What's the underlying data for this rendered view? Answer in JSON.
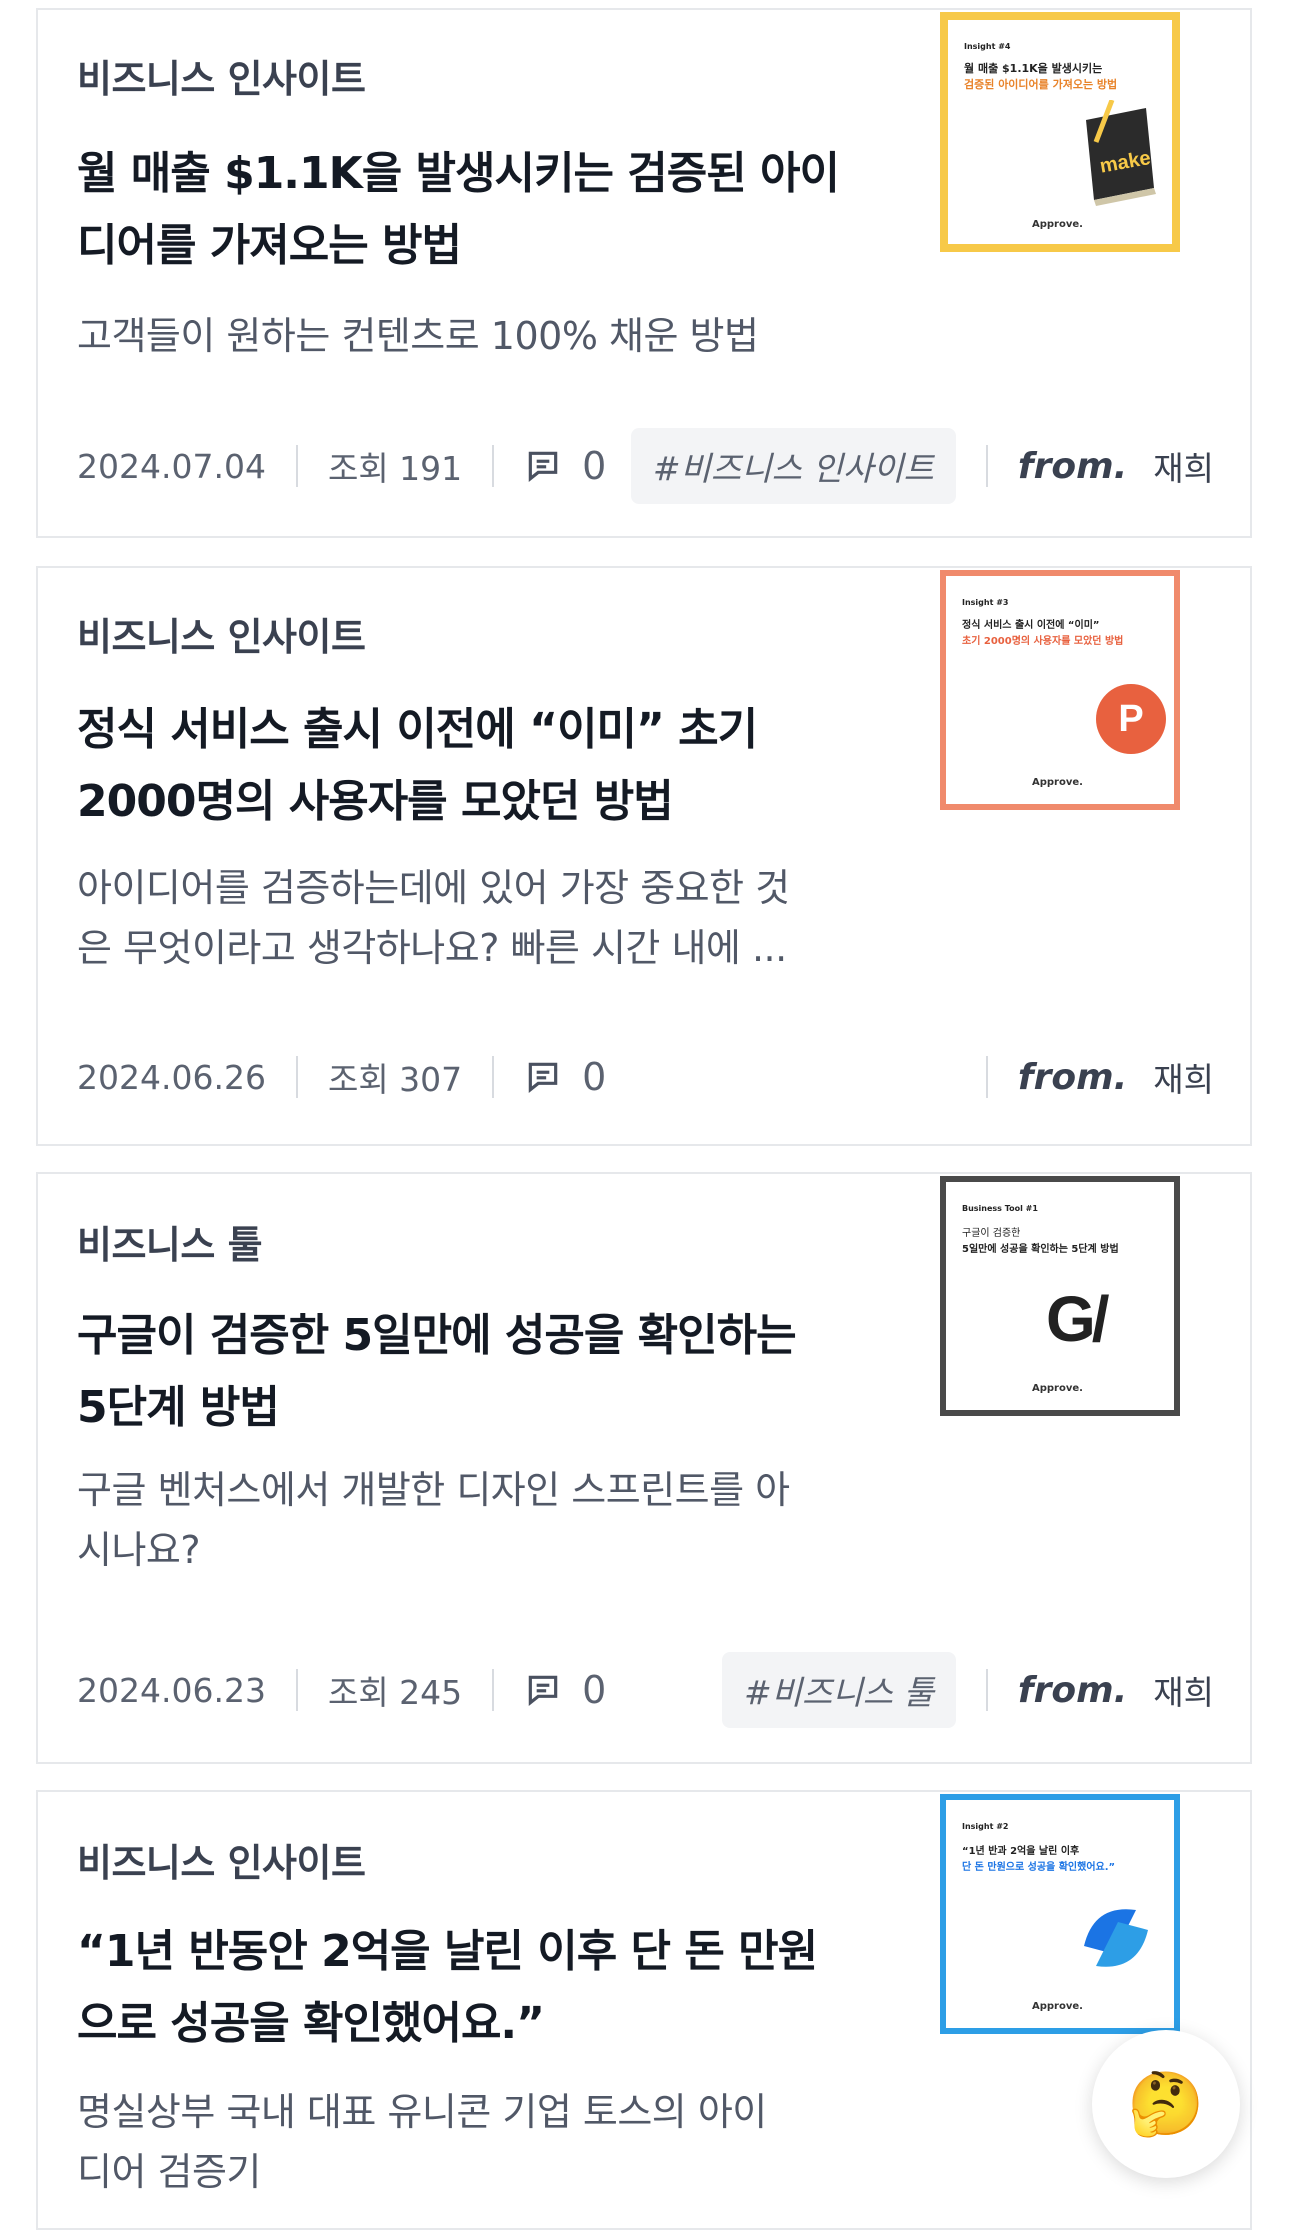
{
  "posts": [
    {
      "category": "비즈니스 인사이트",
      "title_line1": "월 매출 $1.1K을 발생시키는 검증된 아이",
      "title_line2": "디어를 가져오는 방법",
      "desc_line1": "고객들이 원하는 컨텐츠로 100% 채운 방법",
      "desc_line2": "",
      "date": "2024.07.04",
      "views": "조회 191",
      "comments": "0",
      "tag": "#비즈니스 인사이트",
      "from": "from.",
      "author": "재희",
      "thumb": {
        "small": "Insight #4",
        "line1": "월 매출 $1.1K을 발생시키는",
        "line2": "검증된 아이디어를 가져오는 방법",
        "brand": "Approve.",
        "book_text": "make",
        "frame_color": "#f7c948",
        "accent_color": "#e8832a"
      }
    },
    {
      "category": "비즈니스 인사이트",
      "title_line1": "정식 서비스 출시 이전에 “이미” 초기",
      "title_line2": "2000명의 사용자를 모았던 방법",
      "desc_line1": "아이디어를 검증하는데에 있어 가장 중요한 것",
      "desc_line2": "은 무엇이라고 생각하나요? 빠른 시간 내에 ...",
      "date": "2024.06.26",
      "views": "조회 307",
      "comments": "0",
      "tag": "",
      "from": "from.",
      "author": "재희",
      "thumb": {
        "small": "Insight #3",
        "line1": "정식 서비스 출시 이전에 “이미”",
        "line2": "초기 2000명의 사용자를 모았던 방법",
        "brand": "Approve.",
        "logo_letter": "P",
        "frame_color": "#f08a6c",
        "accent_color": "#e8613f"
      }
    },
    {
      "category": "비즈니스 툴",
      "title_line1": "구글이 검증한 5일만에 성공을 확인하는",
      "title_line2": "5단계 방법",
      "desc_line1": "구글 벤처스에서 개발한 디자인 스프린트를 아",
      "desc_line2": "시나요?",
      "date": "2024.06.23",
      "views": "조회 245",
      "comments": "0",
      "tag": "#비즈니스 툴",
      "from": "from.",
      "author": "재희",
      "thumb": {
        "small": "Business Tool #1",
        "line1": "구글이 검증한",
        "line2": "5일만에 성공을 확인하는 5단계 방법",
        "brand": "Approve.",
        "logo_letter": "G/",
        "frame_color": "#4a4a4a",
        "accent_color": "#222222"
      }
    },
    {
      "category": "비즈니스 인사이트",
      "title_line1": "“1년 반동안 2억을 날린 이후 단 돈 만원",
      "title_line2": "으로 성공을 확인했어요.”",
      "desc_line1": "명실상부 국내 대표 유니콘 기업 토스의 아이",
      "desc_line2": "디어 검증기",
      "date": "",
      "views": "",
      "comments": "",
      "tag": "",
      "from": "",
      "author": "",
      "thumb": {
        "small": "Insight #2",
        "line1": "“1년 반과 2억을 날린 이후",
        "line2": "단 돈 만원으로 성공을 확인했어요.”",
        "brand": "Approve.",
        "frame_color": "#2d9ee6",
        "accent_color": "#1b74e4"
      }
    }
  ],
  "fab": {
    "emoji": "🤔"
  }
}
